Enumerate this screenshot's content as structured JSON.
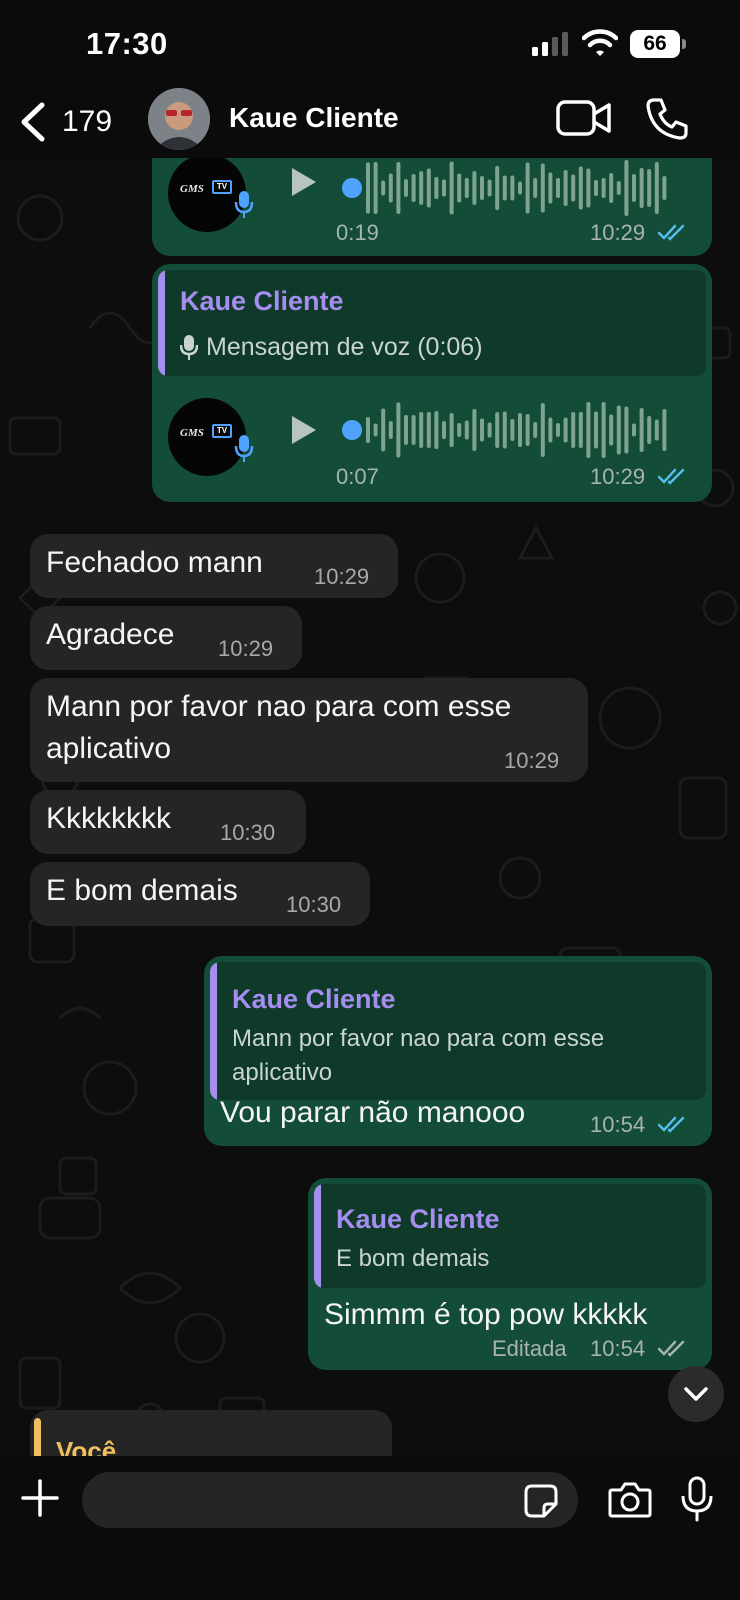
{
  "status_bar": {
    "time": "17:30",
    "battery": "66"
  },
  "header": {
    "back_count": "179",
    "contact_name": "Kaue Cliente"
  },
  "messages": {
    "voice1": {
      "duration": "0:19",
      "time": "10:29"
    },
    "voice2": {
      "quoted_name": "Kaue Cliente",
      "quoted_text": "Mensagem de voz (0:06)",
      "duration": "0:07",
      "time": "10:29"
    },
    "in1": {
      "text": "Fechadoo mann",
      "time": "10:29"
    },
    "in2": {
      "text": "Agradece",
      "time": "10:29"
    },
    "in3": {
      "line1": "Mann por favor nao para com esse",
      "line2": "aplicativo",
      "time": "10:29"
    },
    "in4": {
      "text": "Kkkkkkkk",
      "time": "10:30"
    },
    "in5": {
      "text": "E bom demais",
      "time": "10:30"
    },
    "out1": {
      "quoted_name": "Kaue Cliente",
      "quoted_line1": "Mann por favor nao para com esse",
      "quoted_line2": "aplicativo",
      "text": "Vou parar não manooo",
      "time": "10:54"
    },
    "out2": {
      "quoted_name": "Kaue Cliente",
      "quoted_text": "E bom demais",
      "text": "Simmm é top pow kkkkk",
      "edited": "Editada",
      "time": "10:54"
    },
    "partial": {
      "quoted_name": "Você"
    }
  },
  "composer": {
    "placeholder": ""
  },
  "icons": {
    "back": "chevron-left-icon",
    "video": "video-camera-icon",
    "call": "phone-icon",
    "play": "play-icon",
    "mic": "microphone-icon",
    "ticks": "double-check-icon",
    "scroll": "chevron-down-icon",
    "plus": "plus-icon",
    "sticker": "sticker-icon",
    "camera": "camera-icon"
  },
  "colors": {
    "outgoing_bubble": "#134d37",
    "incoming_bubble": "#252525",
    "quote_accent": "#a58ef0",
    "read_ticks": "#53bdeb",
    "voice_progress": "#4fa3ff",
    "you_accent": "#f0c060"
  }
}
